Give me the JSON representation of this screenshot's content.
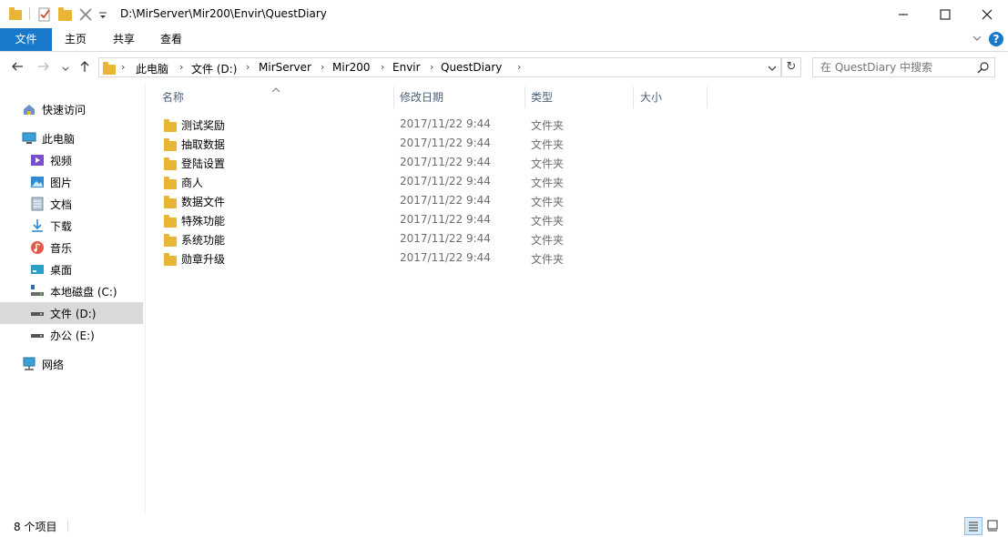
{
  "window": {
    "title": "D:\\MirServer\\Mir200\\Envir\\QuestDiary",
    "minimize": "—",
    "maximize": "☐",
    "close": "✕"
  },
  "ribbon": {
    "tabs": [
      {
        "label": "文件"
      },
      {
        "label": "主页"
      },
      {
        "label": "共享"
      },
      {
        "label": "查看"
      }
    ],
    "help": "?",
    "collapse": "⌄"
  },
  "address": {
    "breadcrumbs": [
      "此电脑",
      "文件 (D:)",
      "MirServer",
      "Mir200",
      "Envir",
      "QuestDiary"
    ],
    "separator": "›",
    "dropdown": "⌄",
    "refresh": "↻"
  },
  "search": {
    "placeholder": "在 QuestDiary 中搜索"
  },
  "sidebar": {
    "items": [
      {
        "label": "快速访问",
        "icon": "star-icon"
      },
      {
        "label": "此电脑",
        "icon": "computer-icon"
      },
      {
        "label": "视频",
        "icon": "video-icon"
      },
      {
        "label": "图片",
        "icon": "picture-icon"
      },
      {
        "label": "文档",
        "icon": "document-icon"
      },
      {
        "label": "下载",
        "icon": "download-icon"
      },
      {
        "label": "音乐",
        "icon": "music-icon"
      },
      {
        "label": "桌面",
        "icon": "desktop-icon"
      },
      {
        "label": "本地磁盘 (C:)",
        "icon": "drive-icon"
      },
      {
        "label": "文件 (D:)",
        "icon": "drive-icon"
      },
      {
        "label": "办公 (E:)",
        "icon": "drive-icon"
      },
      {
        "label": "网络",
        "icon": "network-icon"
      }
    ]
  },
  "columns": {
    "name": "名称",
    "modified": "修改日期",
    "type": "类型",
    "size": "大小"
  },
  "files": [
    {
      "name": "测试奖励",
      "modified": "2017/11/22 9:44",
      "type": "文件夹"
    },
    {
      "name": "抽取数据",
      "modified": "2017/11/22 9:44",
      "type": "文件夹"
    },
    {
      "name": "登陆设置",
      "modified": "2017/11/22 9:44",
      "type": "文件夹"
    },
    {
      "name": "商人",
      "modified": "2017/11/22 9:44",
      "type": "文件夹"
    },
    {
      "name": "数据文件",
      "modified": "2017/11/22 9:44",
      "type": "文件夹"
    },
    {
      "name": "特殊功能",
      "modified": "2017/11/22 9:44",
      "type": "文件夹"
    },
    {
      "name": "系统功能",
      "modified": "2017/11/22 9:44",
      "type": "文件夹"
    },
    {
      "name": "勋章升级",
      "modified": "2017/11/22 9:44",
      "type": "文件夹"
    }
  ],
  "status": {
    "item_count": "8 个项目"
  },
  "colors": {
    "accent": "#1979ca",
    "folder": "#e8b537",
    "selected": "#d9d9d9",
    "header_text": "#4c607a"
  }
}
